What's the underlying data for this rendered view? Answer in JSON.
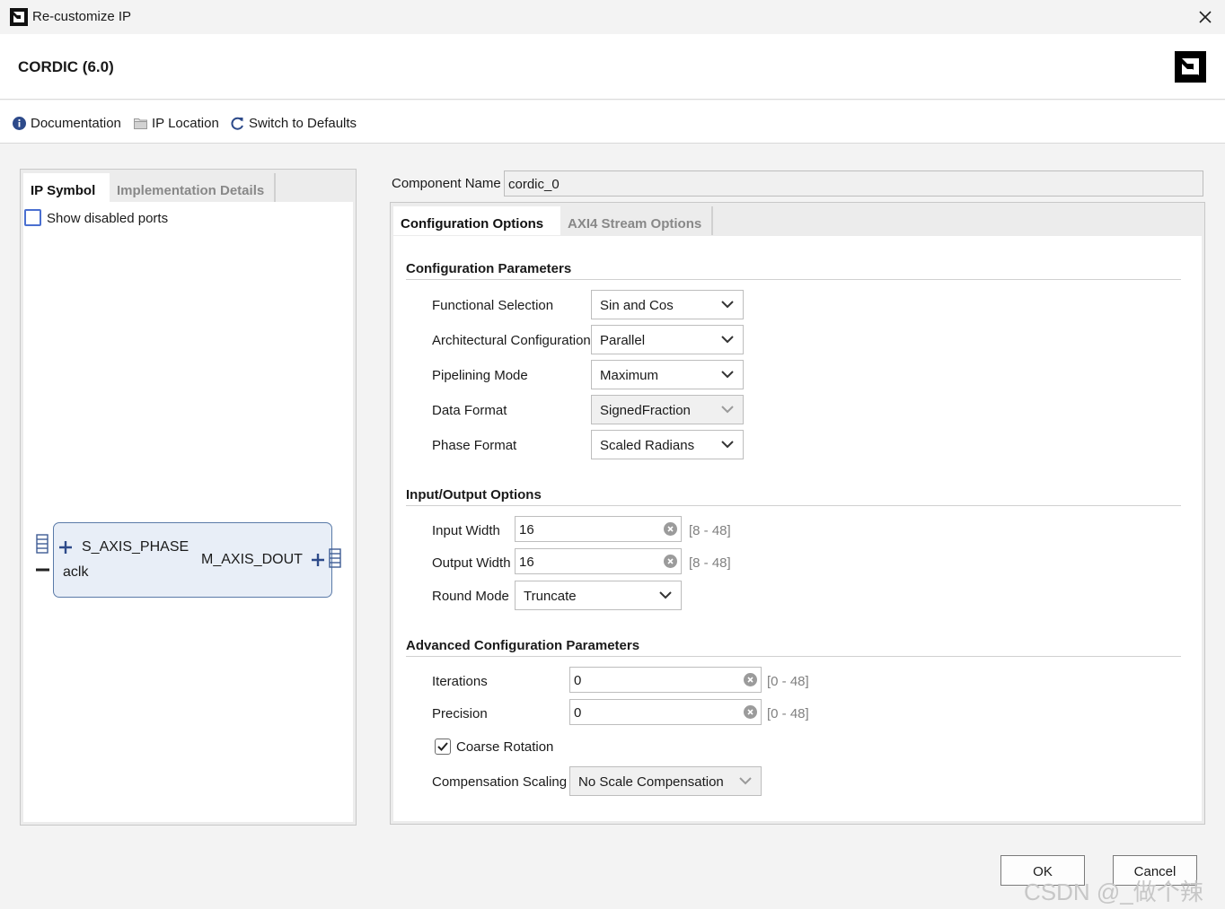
{
  "window": {
    "title": "Re-customize IP",
    "close_icon": "close-icon"
  },
  "header": {
    "ip_name": "CORDIC (6.0)",
    "logo_icon": "amd-logo-icon"
  },
  "toolbar": {
    "documentation": "Documentation",
    "ip_location": "IP Location",
    "switch_defaults": "Switch to Defaults"
  },
  "left_panel": {
    "tabs": [
      "IP Symbol",
      "Implementation Details"
    ],
    "show_disabled_ports": "Show disabled ports",
    "symbol": {
      "port_in": "S_AXIS_PHASE",
      "port_clk": "aclk",
      "port_out": "M_AXIS_DOUT"
    }
  },
  "component": {
    "label": "Component Name",
    "value": "cordic_0"
  },
  "right_panel": {
    "tabs": [
      "Configuration Options",
      "AXI4 Stream Options"
    ],
    "config_params": {
      "title": "Configuration Parameters",
      "functional_selection": {
        "label": "Functional Selection",
        "value": "Sin and Cos"
      },
      "architectural_configuration": {
        "label": "Architectural Configuration",
        "value": "Parallel"
      },
      "pipelining_mode": {
        "label": "Pipelining Mode",
        "value": "Maximum"
      },
      "data_format": {
        "label": "Data Format",
        "value": "SignedFraction"
      },
      "phase_format": {
        "label": "Phase Format",
        "value": "Scaled Radians"
      }
    },
    "io_options": {
      "title": "Input/Output Options",
      "input_width": {
        "label": "Input Width",
        "value": "16",
        "range": "[8 - 48]"
      },
      "output_width": {
        "label": "Output Width",
        "value": "16",
        "range": "[8 - 48]"
      },
      "round_mode": {
        "label": "Round Mode",
        "value": "Truncate"
      }
    },
    "advanced": {
      "title": "Advanced Configuration Parameters",
      "iterations": {
        "label": "Iterations",
        "value": "0",
        "range": "[0 - 48]"
      },
      "precision": {
        "label": "Precision",
        "value": "0",
        "range": "[0 - 48]"
      },
      "coarse_rotation": {
        "label": "Coarse Rotation",
        "checked": true
      },
      "compensation_scaling": {
        "label": "Compensation Scaling",
        "value": "No Scale Compensation"
      }
    }
  },
  "buttons": {
    "ok": "OK",
    "cancel": "Cancel"
  },
  "watermark": "CSDN @_做个辣妹"
}
